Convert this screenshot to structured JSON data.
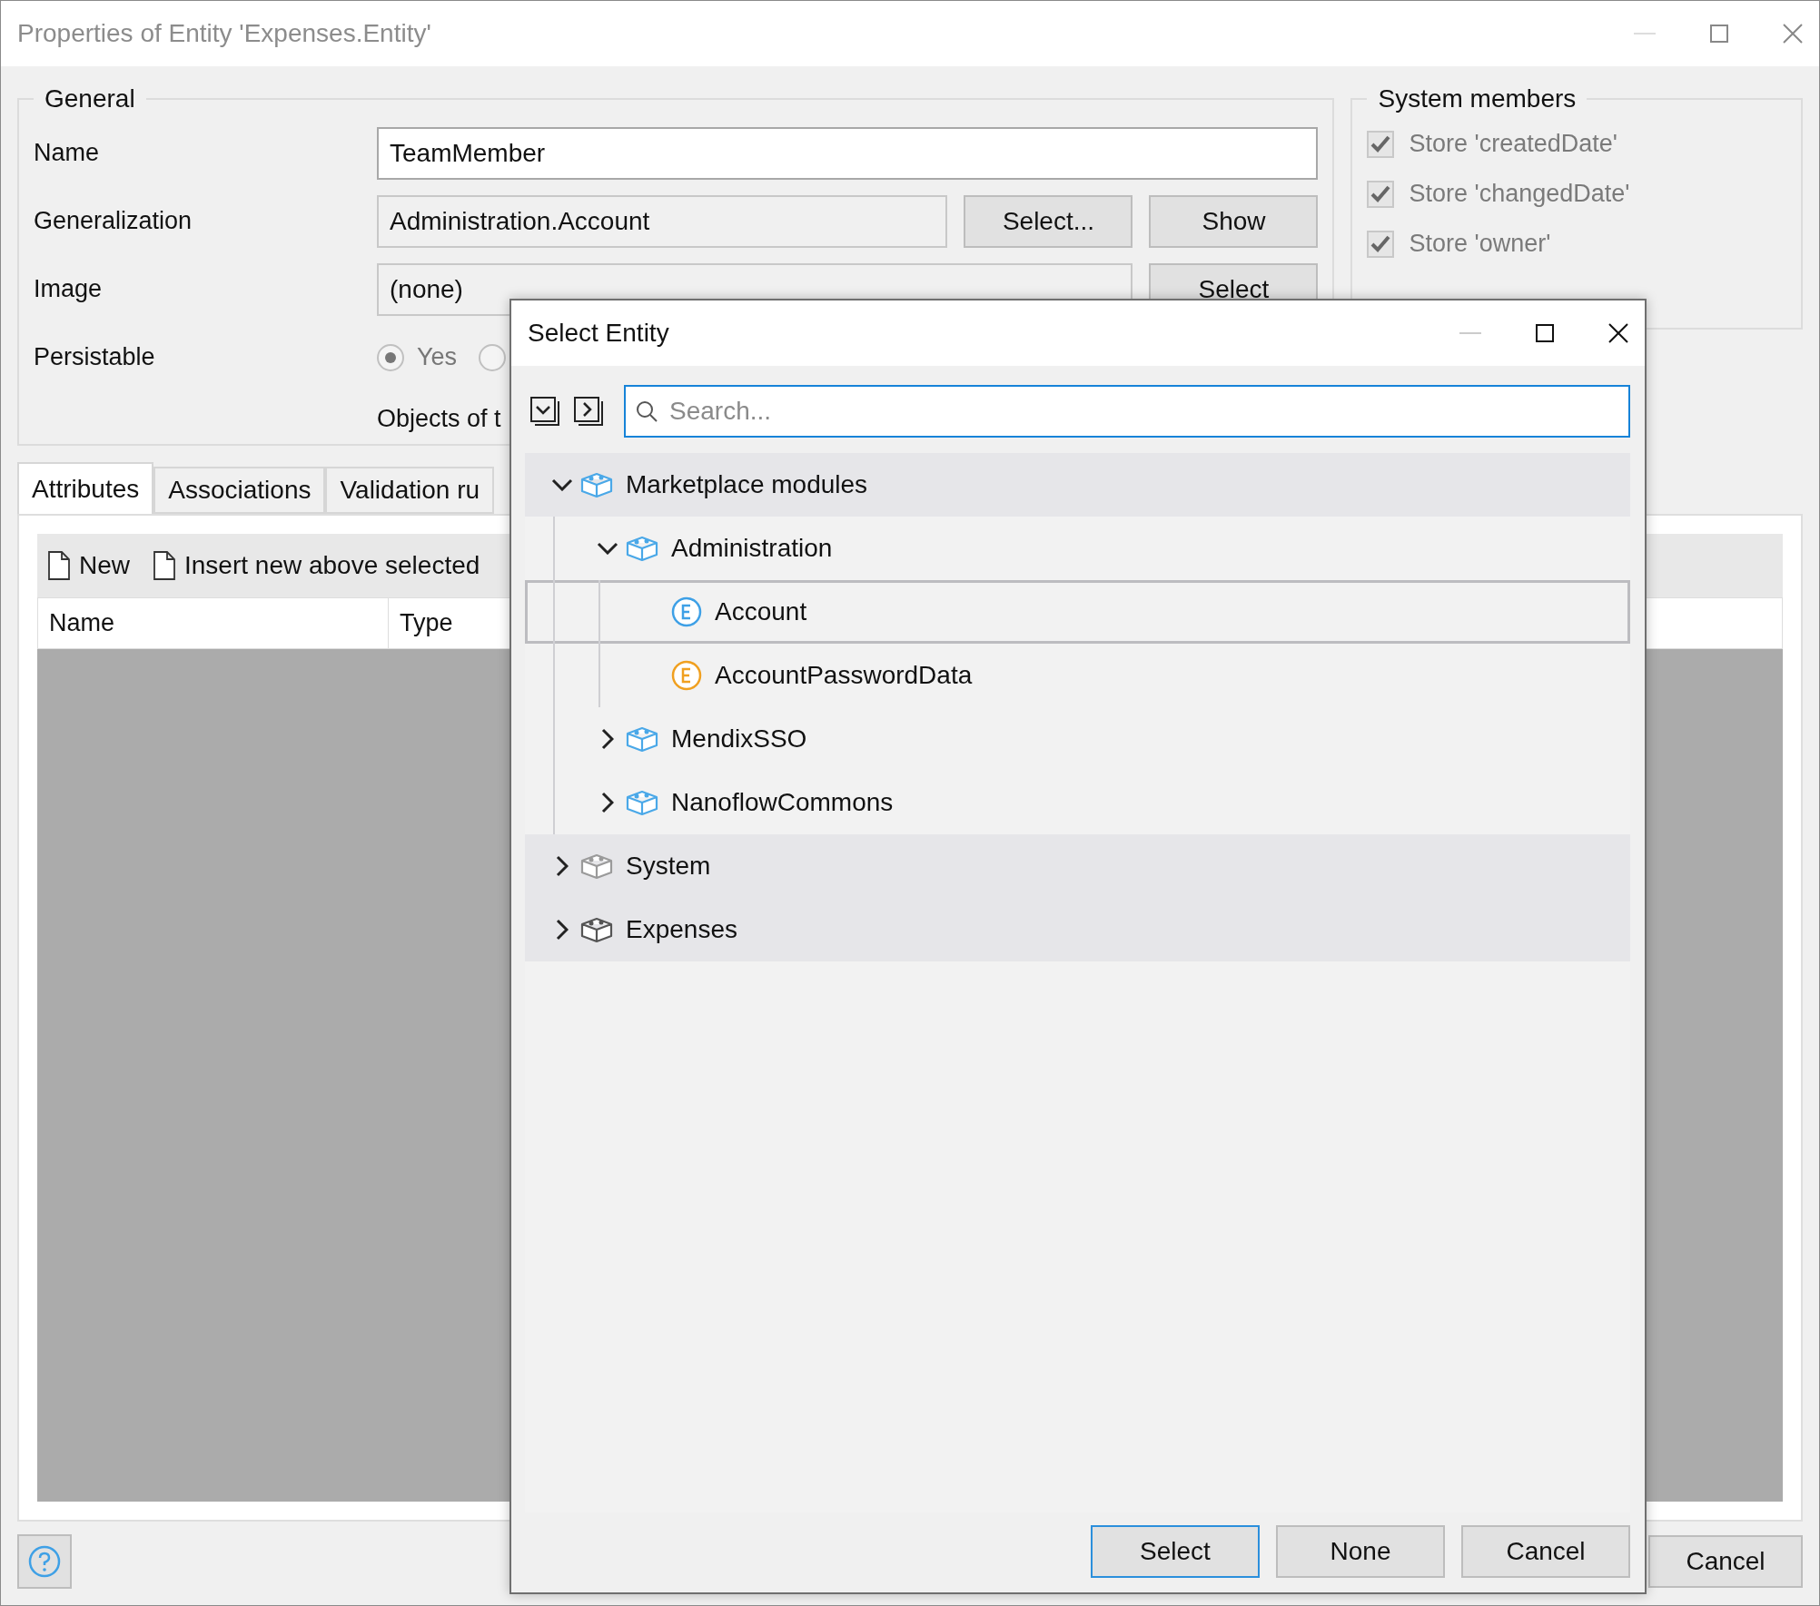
{
  "window": {
    "title": "Properties of Entity 'Expenses.Entity'"
  },
  "general": {
    "title": "General",
    "fields": [
      {
        "label": "Name",
        "value": "TeamMember",
        "kind": "editable"
      },
      {
        "label": "Generalization",
        "value": "Administration.Account",
        "kind": "readonly",
        "buttons": [
          "Select...",
          "Show"
        ]
      },
      {
        "label": "Image",
        "value": "(none)",
        "kind": "readonly",
        "buttons": [
          "Select"
        ]
      }
    ],
    "persistable": {
      "label": "Persistable",
      "options": [
        {
          "label": "Yes",
          "selected": true
        },
        {
          "selected": false
        }
      ]
    },
    "note": "Objects of t"
  },
  "system_members": {
    "title": "System members",
    "items": [
      {
        "label": "Store 'createdDate'",
        "checked": true
      },
      {
        "label": "Store 'changedDate'",
        "checked": true
      },
      {
        "label": "Store 'owner'",
        "checked": true
      }
    ]
  },
  "tabs": [
    {
      "label": "Attributes",
      "selected": true
    },
    {
      "label": "Associations",
      "selected": false
    },
    {
      "label": "Validation ru",
      "selected": false
    }
  ],
  "toolbar": [
    "New",
    "Insert new above selected"
  ],
  "table": {
    "columns": [
      "Name",
      "Type"
    ]
  },
  "footer": {
    "buttons": [
      "Cancel"
    ]
  },
  "dialog": {
    "title": "Select Entity",
    "search": {
      "placeholder": "Search..."
    },
    "tree": [
      {
        "label": "Marketplace modules",
        "kind": "module",
        "color": "#4aa8e8",
        "expanded": true,
        "selected": false,
        "children": [
          {
            "label": "Administration",
            "kind": "module",
            "color": "#4aa8e8",
            "expanded": true,
            "selected": false,
            "children": [
              {
                "label": "Account",
                "kind": "entity",
                "color": "#3ea0e6",
                "selected": true
              },
              {
                "label": "AccountPasswordData",
                "kind": "entity",
                "color": "#f0a020",
                "selected": false
              }
            ]
          },
          {
            "label": "MendixSSO",
            "kind": "module",
            "color": "#4aa8e8",
            "expanded": false,
            "selected": false
          },
          {
            "label": "NanoflowCommons",
            "kind": "module",
            "color": "#4aa8e8",
            "expanded": false,
            "selected": false
          }
        ]
      },
      {
        "label": "System",
        "kind": "module",
        "color": "#9a9a9a",
        "expanded": false,
        "selected": false
      },
      {
        "label": "Expenses",
        "kind": "module",
        "color": "#555555",
        "expanded": false,
        "selected": false
      }
    ],
    "buttons": [
      {
        "label": "Select",
        "default": true
      },
      {
        "label": "None",
        "default": false
      },
      {
        "label": "Cancel",
        "default": false
      }
    ]
  }
}
